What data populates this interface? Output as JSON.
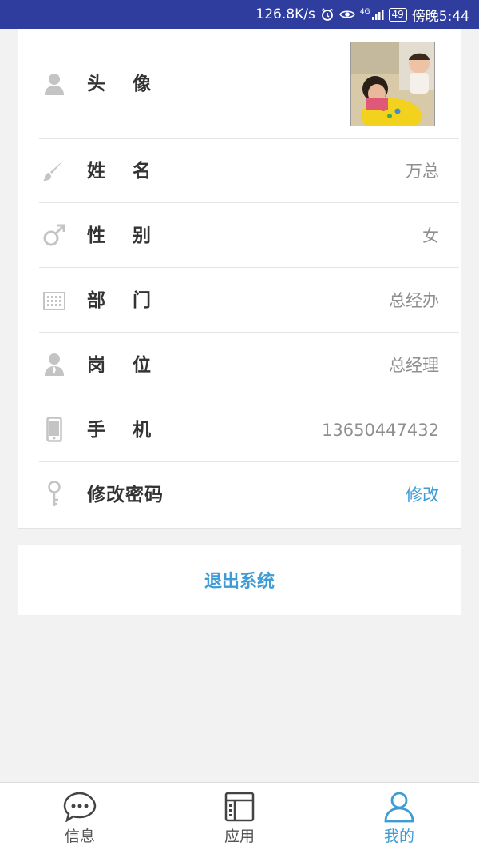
{
  "status_bar": {
    "speed": "126.8K/s",
    "network": "4G",
    "battery": "49",
    "time": "傍晚5:44"
  },
  "profile": {
    "avatar_label": "头像",
    "rows": [
      {
        "label": "姓名",
        "value": "万总"
      },
      {
        "label": "性别",
        "value": "女"
      },
      {
        "label": "部门",
        "value": "总经办"
      },
      {
        "label": "岗位",
        "value": "总经理"
      },
      {
        "label": "手机",
        "value": "13650447432"
      }
    ],
    "password": {
      "label": "修改密码",
      "action": "修改"
    }
  },
  "logout_label": "退出系统",
  "tabs": [
    {
      "label": "信息",
      "icon": "chat-icon"
    },
    {
      "label": "应用",
      "icon": "apps-icon"
    },
    {
      "label": "我的",
      "icon": "person-icon",
      "active": true
    }
  ],
  "colors": {
    "status_bar": "#2f3d9e",
    "accent": "#3d9bd6",
    "icon_gray": "#c4c4c4"
  }
}
